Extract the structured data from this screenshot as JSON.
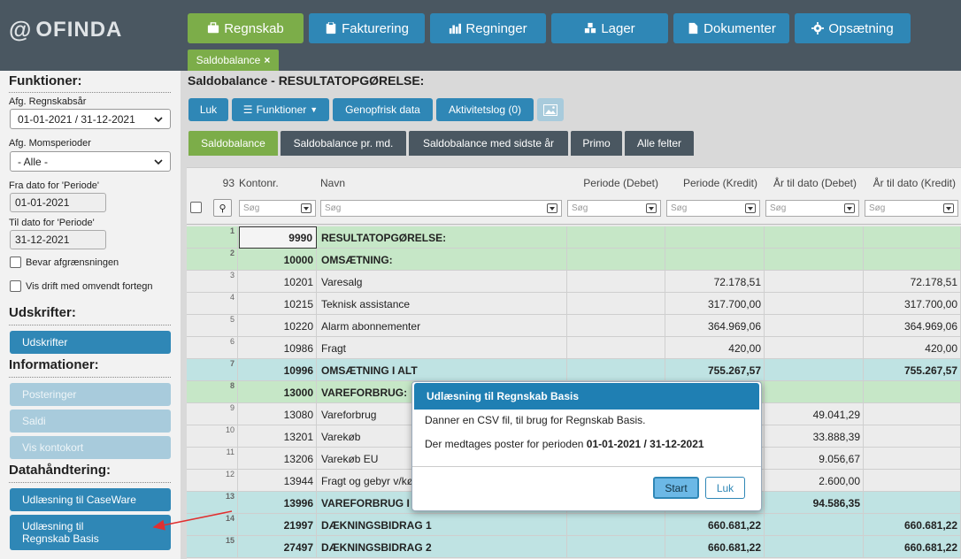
{
  "app": {
    "logo": "OFINDA"
  },
  "nav": [
    {
      "label": "Regnskab",
      "icon": "briefcase-icon",
      "active": true
    },
    {
      "label": "Fakturering",
      "icon": "clipboard-icon"
    },
    {
      "label": "Regninger",
      "icon": "bar-chart-icon"
    },
    {
      "label": "Lager",
      "icon": "cubes-icon"
    },
    {
      "label": "Dokumenter",
      "icon": "document-icon"
    },
    {
      "label": "Opsætning",
      "icon": "gear-icon"
    }
  ],
  "subtab": {
    "label": "Saldobalance",
    "close": "×"
  },
  "sidebar": {
    "functions_title": "Funktioner:",
    "fiscal_year_label": "Afg. Regnskabsår",
    "fiscal_year_value": "01-01-2021 / 31-12-2021",
    "vat_label": "Afg. Momsperioder",
    "vat_value": "- Alle -",
    "from_label": "Fra dato for 'Periode'",
    "from_value": "01-01-2021",
    "to_label": "Til dato for 'Periode'",
    "to_value": "31-12-2021",
    "keep_limit": "Bevar afgrænsningen",
    "reverse_sign": "Vis drift med omvendt fortegn",
    "prints_title": "Udskrifter:",
    "prints_button": "Udskrifter",
    "info_title": "Informationer:",
    "postings": "Posteringer",
    "balances": "Saldi",
    "account_card": "Vis kontokort",
    "data_title": "Datahåndtering:",
    "export_caseware": "Udlæsning til CaseWare",
    "export_basis_1": "Udlæsning til",
    "export_basis_2": "Regnskab Basis"
  },
  "main": {
    "title": "Saldobalance - RESULTATOPGØRELSE:",
    "toolbar": {
      "close": "Luk",
      "functions": "Funktioner",
      "refresh": "Genopfrisk data",
      "activity": "Aktivitetslog (0)"
    },
    "tabs": [
      "Saldobalance",
      "Saldobalance pr. md.",
      "Saldobalance med sidste år",
      "Primo",
      "Alle felter"
    ]
  },
  "grid": {
    "count": "93",
    "headers": [
      "Kontonr.",
      "Navn",
      "Periode (Debet)",
      "Periode (Kredit)",
      "År til dato (Debet)",
      "År til dato (Kredit)"
    ],
    "search_placeholder": "Søg",
    "rows": [
      {
        "n": "1",
        "acct": "9990",
        "name": "RESULTATOPGØRELSE:",
        "pd": "",
        "pk": "",
        "ad": "",
        "ak": "",
        "style": "green",
        "bold": true
      },
      {
        "n": "2",
        "acct": "10000",
        "name": "OMSÆTNING:",
        "pd": "",
        "pk": "",
        "ad": "",
        "ak": "",
        "style": "green",
        "bold": true
      },
      {
        "n": "3",
        "acct": "10201",
        "name": "Varesalg",
        "pd": "",
        "pk": "72.178,51",
        "ad": "",
        "ak": "72.178,51",
        "style": "plain"
      },
      {
        "n": "4",
        "acct": "10215",
        "name": "Teknisk assistance",
        "pd": "",
        "pk": "317.700,00",
        "ad": "",
        "ak": "317.700,00",
        "style": "plain"
      },
      {
        "n": "5",
        "acct": "10220",
        "name": "Alarm abonnementer",
        "pd": "",
        "pk": "364.969,06",
        "ad": "",
        "ak": "364.969,06",
        "style": "plain"
      },
      {
        "n": "6",
        "acct": "10986",
        "name": "Fragt",
        "pd": "",
        "pk": "420,00",
        "ad": "",
        "ak": "420,00",
        "style": "plain"
      },
      {
        "n": "7",
        "acct": "10996",
        "name": "OMSÆTNING I ALT",
        "pd": "",
        "pk": "755.267,57",
        "ad": "",
        "ak": "755.267,57",
        "style": "teal",
        "bold": true
      },
      {
        "n": "8",
        "acct": "13000",
        "name": "VAREFORBRUG:",
        "pd": "",
        "pk": "",
        "ad": "",
        "ak": "",
        "style": "green",
        "bold": true
      },
      {
        "n": "9",
        "acct": "13080",
        "name": "Vareforbrug",
        "pd": "",
        "pk": "",
        "ad": "49.041,29",
        "ak": "",
        "style": "plain"
      },
      {
        "n": "10",
        "acct": "13201",
        "name": "Varekøb",
        "pd": "",
        "pk": "",
        "ad": "33.888,39",
        "ak": "",
        "style": "plain"
      },
      {
        "n": "11",
        "acct": "13206",
        "name": "Varekøb EU",
        "pd": "",
        "pk": "",
        "ad": "9.056,67",
        "ak": "",
        "style": "plain"
      },
      {
        "n": "12",
        "acct": "13944",
        "name": "Fragt og gebyr v/kø",
        "pd": "",
        "pk": "",
        "ad": "2.600,00",
        "ak": "",
        "style": "plain"
      },
      {
        "n": "13",
        "acct": "13996",
        "name": "VAREFORBRUG I",
        "pd": "",
        "pk": "",
        "ad": "94.586,35",
        "ak": "",
        "style": "teal",
        "bold": true
      },
      {
        "n": "14",
        "acct": "21997",
        "name": "DÆKNINGSBIDRAG 1",
        "pd": "",
        "pk": "660.681,22",
        "ad": "",
        "ak": "660.681,22",
        "style": "teal",
        "bold": true
      },
      {
        "n": "15",
        "acct": "27497",
        "name": "DÆKNINGSBIDRAG 2",
        "pd": "",
        "pk": "660.681,22",
        "ad": "",
        "ak": "660.681,22",
        "style": "teal",
        "bold": true
      }
    ]
  },
  "modal": {
    "title": "Udlæsning til Regnskab Basis",
    "line1": "Danner en CSV fil, til brug for Regnskab Basis.",
    "line2_prefix": "Der medtages poster for perioden ",
    "date_from": "01-01-2021",
    "date_sep": " / ",
    "date_to": "31-12-2021",
    "start": "Start",
    "close": "Luk"
  },
  "colors": {
    "accent": "#2f87b6",
    "active": "#7cad49",
    "header": "#4a5761",
    "arrow": "#e03030"
  }
}
